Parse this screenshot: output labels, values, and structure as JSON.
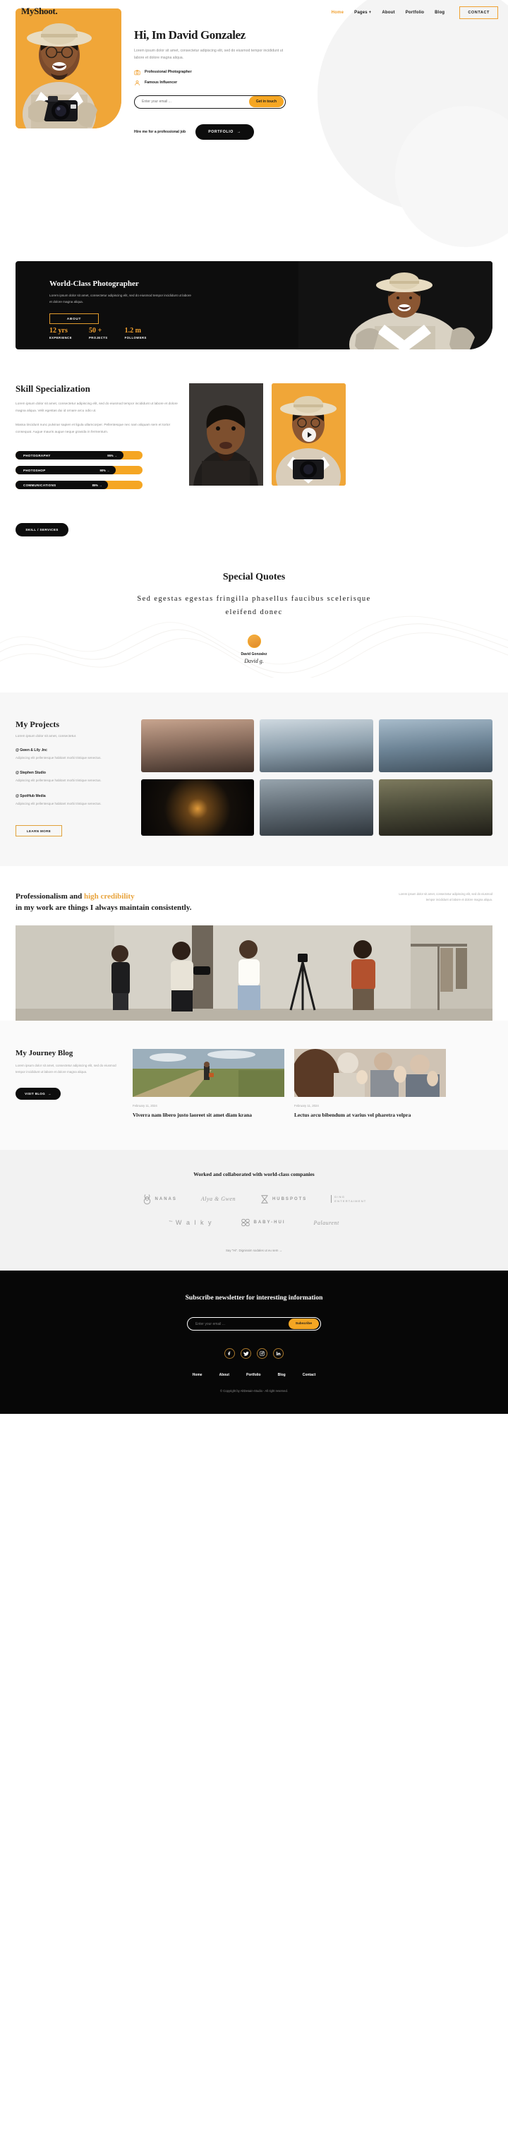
{
  "brand": "MyShoot.",
  "nav": {
    "items": [
      {
        "label": "Home",
        "active": true
      },
      {
        "label": "Pages +",
        "active": false
      },
      {
        "label": "About",
        "active": false
      },
      {
        "label": "Portfolio",
        "active": false
      },
      {
        "label": "Blog",
        "active": false
      }
    ],
    "contact_label": "CONTACT"
  },
  "hero": {
    "title": "Hi, Im David Gonzalez",
    "subtitle": "Lorem ipsum dolor sit amet, consectetur adipiscing elit, sed do eiusmod tempor incididunt ut labore et dolore magna aliqua.",
    "features": [
      {
        "label": "Professional Photographer",
        "icon": "camera-icon"
      },
      {
        "label": "Famous Influencer",
        "icon": "user-icon"
      }
    ],
    "email_placeholder": "Enter your email ...",
    "email_value": "",
    "get_in_touch_label": "Get in touch",
    "hire_text": "Hire me for a professional job",
    "portfolio_label": "PORTFOLIO"
  },
  "banner": {
    "title": "World-Class Photographer",
    "subtitle": "Lorem ipsum dolor sit amet, consectetur adipiscing elit, sed do eiusmod tempor incididunt ut labore et dolore magna aliqua.",
    "about_label": "ABOUT",
    "stats": [
      {
        "value": "12 yrs",
        "label": "EXPERIENCE"
      },
      {
        "value": "50 +",
        "label": "PROJECTS"
      },
      {
        "value": "1.2 m",
        "label": "FOLLOWERS"
      }
    ]
  },
  "skill": {
    "title": "Skill Specialization",
    "paragraph1": "Lorem ipsum dolor sit amet, consectetur adipiscing elit, sed do eiusmod tempor incididunt ut labore et dolore magna aliqua. Velit egestas dui id ornare arcu odio ut.",
    "paragraph2": "Massa tincidunt nunc pulvinar sapien et ligula ullamcorper. Pellentesque nec nam aliquam sem et tortor consequat. Augue mauris augue neque gravida in fermentum.",
    "bars": [
      {
        "name": "PHOTOGRAPHY",
        "pct": "95%",
        "value": 95
      },
      {
        "name": "PHOTOSHOP",
        "pct": "90%",
        "value": 90
      },
      {
        "name": "COMMUNICATIONS",
        "pct": "85%",
        "value": 85
      }
    ],
    "cta_label": "SKILL / SERVICES"
  },
  "quotes": {
    "title": "Special Quotes",
    "text": "Sed egestas egestas fringilla phasellus faucibus scelerisque eleifend donec",
    "author_name": "David Gonzalez",
    "author_signature": "David g."
  },
  "projects": {
    "title": "My Projects",
    "subtitle": "Lorem ipsum dolor sit amet, consectetur.",
    "items": [
      {
        "name": "@ Gwen & Lily .Inc",
        "desc": "Adipiscing elit pellentesque habitant morbi tristique senectus."
      },
      {
        "name": "@ Stephen Studio",
        "desc": "Adipiscing elit pellentesque habitant morbi tristique senectus."
      },
      {
        "name": "@ SpotHub Media",
        "desc": "Adipiscing elit pellentesque habitant morbi tristique senectus."
      }
    ],
    "learn_more_label": "LEARN MORE",
    "gallery": [
      {
        "name": "mountain-sunset",
        "c1": "#6f5a52",
        "c2": "#c9a089"
      },
      {
        "name": "snowy-village",
        "c1": "#7b8d9c",
        "c2": "#cdd7de"
      },
      {
        "name": "city-waterfront",
        "c1": "#5d6f80",
        "c2": "#9fb2c0"
      },
      {
        "name": "dark-tunnel",
        "c1": "#0c0c0c",
        "c2": "#2a2018"
      },
      {
        "name": "snow-forest",
        "c1": "#39424a",
        "c2": "#8d9aa3"
      },
      {
        "name": "forest-canopy",
        "c1": "#2c2a24",
        "c2": "#6e6a56"
      }
    ]
  },
  "professionalism": {
    "head_1": "Professionalism and ",
    "head_highlight": "high credibility",
    "head_2": "in my work are things I always maintain consistently.",
    "note": "Lorem ipsum dolor sit amet, consectetur adipiscing elit, sed do eiusmod tempor incididunt ut labore et dolore magna aliqua."
  },
  "blog": {
    "title": "My Journey Blog",
    "subtitle": "Lorem ipsum dolor sit amet, consectetur adipiscing elit, sed do eiusmod tempor incididunt ut labore et dolore magna aliqua.",
    "visit_label": "VISIT BLOG",
    "posts": [
      {
        "date": "February 11, 2024",
        "headline": "Viverra nam libero justo laoreet sit amet diam krana",
        "img": "woman-with-suitcase"
      },
      {
        "date": "February 11, 2024",
        "headline": "Lectus arcu bibendum at varius vel pharetra velpra",
        "img": "audience-applause"
      }
    ]
  },
  "clients": {
    "title": "Worked and collaborated with world-class companies",
    "row1": [
      {
        "name": "NANAS",
        "style": "spaced"
      },
      {
        "name": "Alya & Gwen",
        "style": "script"
      },
      {
        "name": "HUBSPOTS",
        "style": "bold"
      },
      {
        "name": "DING ENTERTAIMENT",
        "style": "two-line"
      }
    ],
    "row2": [
      {
        "name": "The Walky",
        "style": "walky"
      },
      {
        "name": "BABY-HUI",
        "style": "bold"
      },
      {
        "name": "Palaurent",
        "style": "script"
      }
    ],
    "say_hi": "Say \"Hi\". Dignissim sodales ut eu sem"
  },
  "footer": {
    "title": "Subscribe newsletter for interesting information",
    "email_placeholder": "Enter your email ...",
    "email_value": "",
    "subscribe_label": "Subscribe",
    "socials": [
      "facebook-icon",
      "twitter-icon",
      "instagram-icon",
      "linkedin-icon"
    ],
    "nav": [
      "Home",
      "About",
      "Portfolio",
      "Blog",
      "Contact"
    ],
    "copyright": "© Copyright by AltDesain-Studio - All right reserved."
  },
  "colors": {
    "accent": "#f5a623",
    "accent_dark": "#e09b2d",
    "dark": "#0d0d0d",
    "muted": "#9a9a9a"
  }
}
